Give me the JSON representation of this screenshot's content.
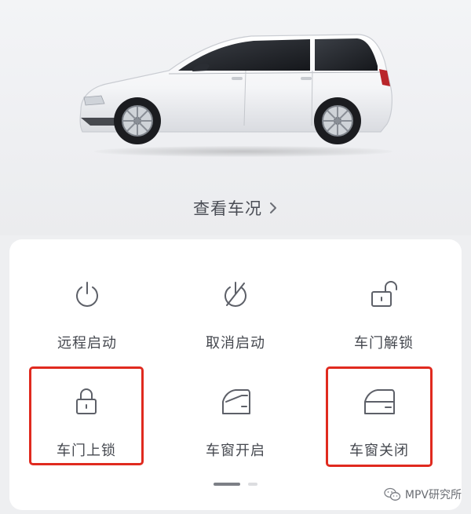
{
  "vehicle": {
    "image_icon": "white-mpv-car",
    "status_link_label": "查看车况",
    "status_link_icon": "chevron-right-icon"
  },
  "controls": {
    "accent_highlight_color": "#e02a1f",
    "items": [
      {
        "label": "远程启动",
        "icon": "power-icon",
        "highlighted": false
      },
      {
        "label": "取消启动",
        "icon": "power-off-icon",
        "highlighted": false
      },
      {
        "label": "车门解锁",
        "icon": "unlock-icon",
        "highlighted": false
      },
      {
        "label": "车门上锁",
        "icon": "lock-icon",
        "highlighted": true
      },
      {
        "label": "车窗开启",
        "icon": "window-open-icon",
        "highlighted": false
      },
      {
        "label": "车窗关闭",
        "icon": "window-close-icon",
        "highlighted": true
      }
    ]
  },
  "pagination": {
    "current_page": 1,
    "total_pages": 2
  },
  "watermark": {
    "text": "MPV研究所",
    "icon": "wechat-icon"
  }
}
